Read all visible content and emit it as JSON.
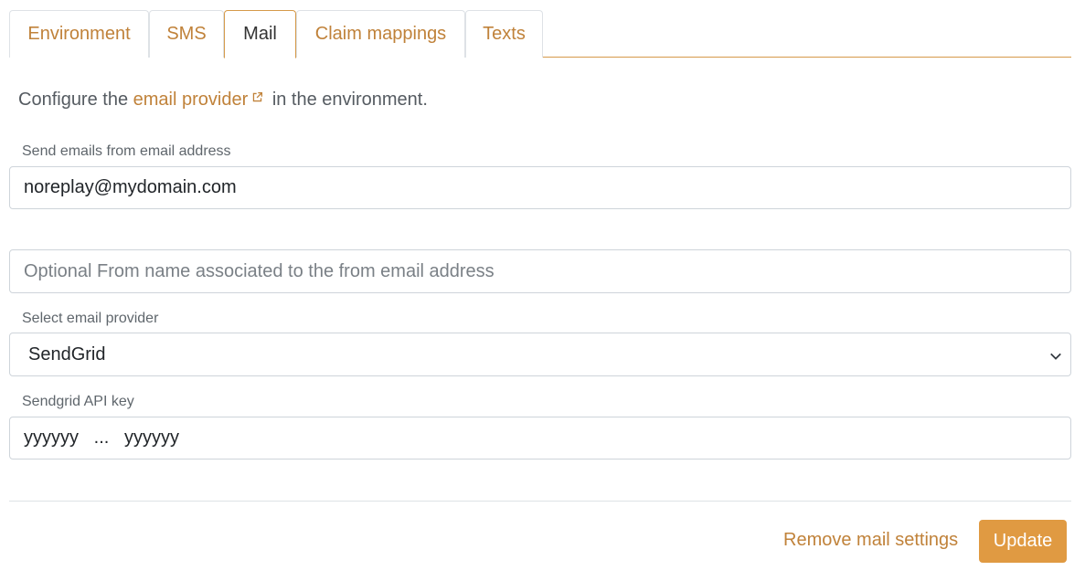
{
  "tabs": [
    {
      "label": "Environment",
      "active": false
    },
    {
      "label": "SMS",
      "active": false
    },
    {
      "label": "Mail",
      "active": true
    },
    {
      "label": "Claim mappings",
      "active": false
    },
    {
      "label": "Texts",
      "active": false
    }
  ],
  "intro": {
    "prefix": "Configure the",
    "link_text": "email provider",
    "suffix": "in the environment."
  },
  "from_email": {
    "label": "Send emails from email address",
    "value": "noreplay@mydomain.com"
  },
  "from_name": {
    "placeholder": "Optional From name associated to the from email address"
  },
  "provider": {
    "label": "Select email provider",
    "selected": "SendGrid"
  },
  "api_key": {
    "label": "Sendgrid API key",
    "value": "yyyyyy   ...   yyyyyy"
  },
  "actions": {
    "remove_label": "Remove mail settings",
    "update_label": "Update"
  },
  "colors": {
    "accent": "#c0823a",
    "primary_button": "#e09a42"
  }
}
